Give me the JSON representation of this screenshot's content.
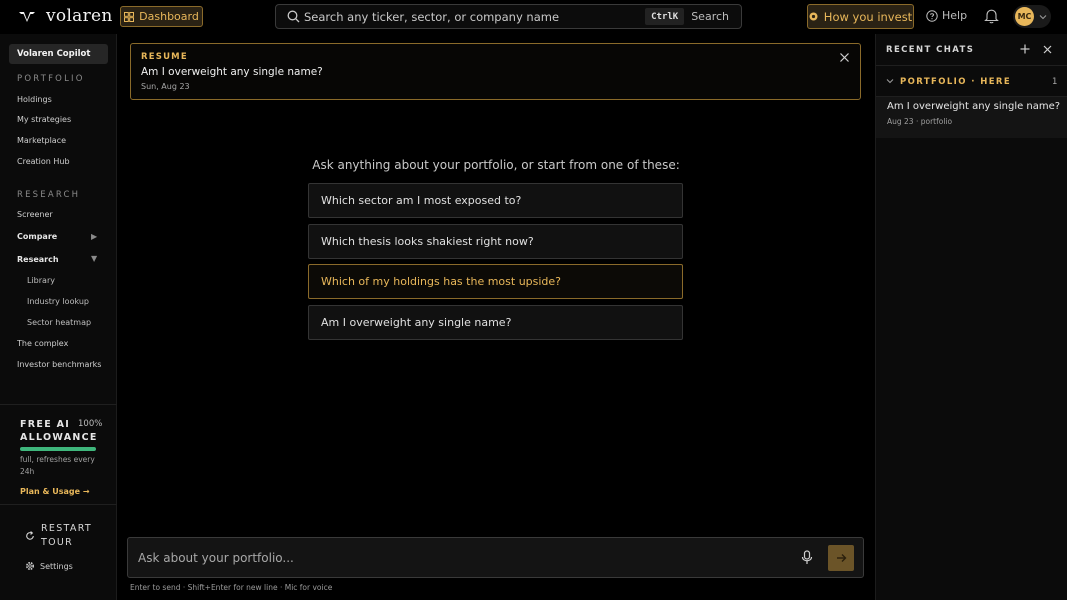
{
  "header": {
    "logo_text": "volaren",
    "dashboard_label": "Dashboard",
    "search_placeholder": "Search any ticker, sector, or company name",
    "search_shortcut": "CtrlK",
    "search_button": "Search",
    "how_you_invest_label": "How you invest",
    "help_label": "Help",
    "avatar_initials": "MC"
  },
  "sidebar": {
    "copilot_label": "Volaren Copilot",
    "portfolio_title": "PORTFOLIO",
    "portfolio_items": [
      "Holdings",
      "My strategies",
      "Marketplace",
      "Creation Hub"
    ],
    "research_title": "RESEARCH",
    "screener": "Screener",
    "compare": "Compare",
    "research": "Research",
    "research_sub": [
      "Library",
      "Industry lookup",
      "Sector heatmap"
    ],
    "the_complex": "The complex",
    "investor_benchmarks": "Investor benchmarks",
    "allowance": {
      "title": "FREE AI ALLOWANCE",
      "percent_label": "100%",
      "fill_fraction": 1.0,
      "note": "full, refreshes every 24h",
      "plan_link": "Plan & Usage →"
    },
    "restart_tour": "RESTART TOUR",
    "settings": "Settings"
  },
  "main": {
    "resume": {
      "tag": "RESUME",
      "title": "Am I overweight any single name?",
      "date": "Sun, Aug 23"
    },
    "prompt": "Ask anything about your portfolio, or start from one of these:",
    "suggestions": [
      "Which sector am I most exposed to?",
      "Which thesis looks shakiest right now?",
      "Which of my holdings has the most upside?",
      "Am I overweight any single name?"
    ],
    "input_placeholder": "Ask about your portfolio...",
    "hint": "Enter to send · Shift+Enter for new line · Mic for voice"
  },
  "recent_chats": {
    "title": "RECENT CHATS",
    "group_title": "PORTFOLIO · HERE",
    "group_count": "1",
    "items": [
      {
        "title": "Am I overweight any single name?",
        "meta": "Aug 23 · portfolio"
      }
    ]
  },
  "colors": {
    "accent": "#e8b75a",
    "accent_border": "#8a6a2a",
    "progress": "#3fb67c",
    "background": "#000000"
  },
  "icons": [
    "logo-mark-icon",
    "dashboard-grid-icon",
    "search-icon",
    "coin-icon",
    "help-circle-icon",
    "bell-icon",
    "chevron-down-icon",
    "close-icon",
    "restart-icon",
    "gear-icon",
    "microphone-icon",
    "arrow-right-icon",
    "plus-icon",
    "triangle-right-icon",
    "triangle-down-icon"
  ]
}
